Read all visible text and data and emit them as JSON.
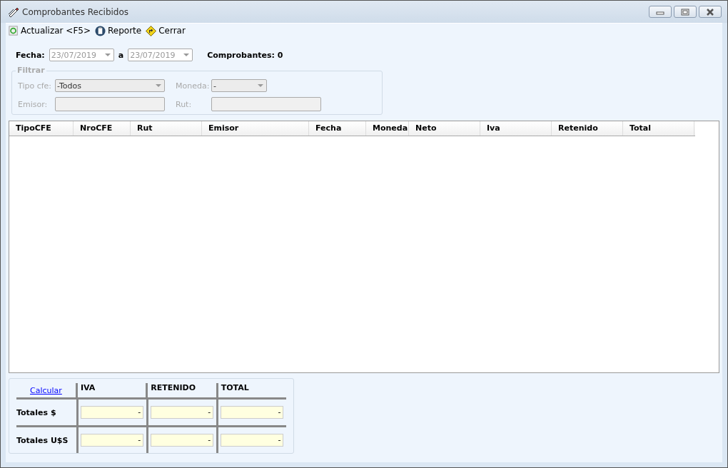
{
  "window": {
    "title": "Comprobantes Recibidos"
  },
  "toolbar": [
    {
      "kind": "refresh",
      "label": "Actualizar <F5>"
    },
    {
      "kind": "report",
      "label": "Reporte"
    },
    {
      "kind": "close",
      "label": "Cerrar"
    }
  ],
  "date_range": {
    "label": "Fecha:",
    "from": "23/07/2019",
    "separator": "a",
    "to": "23/07/2019",
    "count_label": "Comprobantes: 0"
  },
  "filter": {
    "title": "Filtrar",
    "disabled": true,
    "tipo_label": "Tipo cfe:",
    "tipo_value": "-Todos",
    "moneda_label": "Moneda:",
    "moneda_value": "-",
    "emisor_label": "Emisor:",
    "rut_label": "Rut:"
  },
  "table": {
    "columns": [
      "TipoCFE",
      "NroCFE",
      "Rut",
      "Emisor",
      "Fecha",
      "Moneda",
      "Neto",
      "Iva",
      "Retenido",
      "Total"
    ]
  },
  "totals": {
    "link": "Calcular",
    "columns": [
      "IVA",
      "RETENIDO",
      "TOTAL"
    ],
    "rows": [
      {
        "label": "Totales $",
        "values": [
          "-",
          "-",
          "-"
        ]
      },
      {
        "label": "Totales U$S",
        "values": [
          "-",
          "-",
          "-"
        ]
      }
    ]
  }
}
